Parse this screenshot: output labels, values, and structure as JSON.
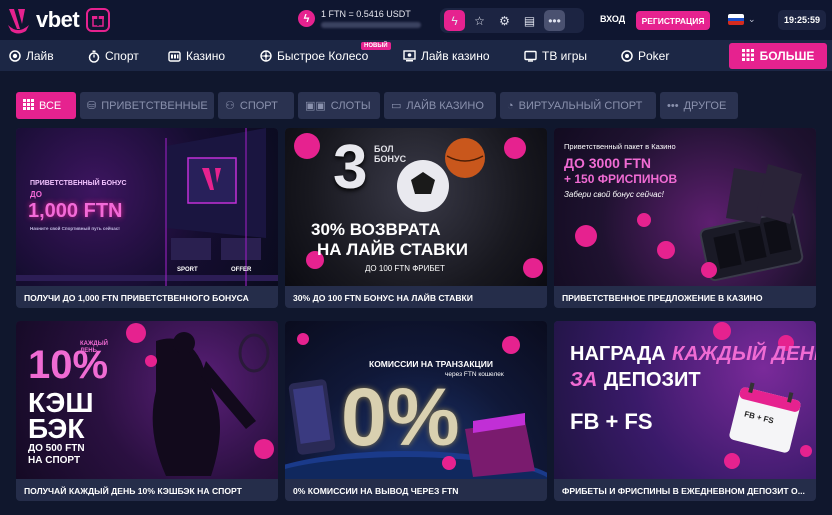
{
  "header": {
    "brand": "vbet",
    "rate": "1 FTN = 0.5416 USDT",
    "login_label": "ВХОД",
    "register_label": "РЕГИСТРАЦИЯ",
    "time": "19:25:59"
  },
  "nav": {
    "items": [
      {
        "label": "Лайв",
        "icon": "live-icon"
      },
      {
        "label": "Спорт",
        "icon": "stopwatch-icon"
      },
      {
        "label": "Казино",
        "icon": "casino-icon"
      },
      {
        "label": "Быстрое Колесо",
        "icon": "wheel-icon"
      },
      {
        "label": "Лайв казино",
        "icon": "live-casino-icon"
      },
      {
        "label": "ТВ игры",
        "icon": "tv-icon"
      },
      {
        "label": "Poker",
        "icon": "poker-chip-icon"
      }
    ],
    "new_badge": "НОВЫЙ",
    "more_label": "БОЛЬШЕ"
  },
  "filters": [
    {
      "label": "ВСЕ",
      "active": true
    },
    {
      "label": "ПРИВЕТСТВЕННЫЕ",
      "active": false
    },
    {
      "label": "СПОРТ",
      "active": false
    },
    {
      "label": "СЛОТЫ",
      "active": false
    },
    {
      "label": "ЛАЙВ КАЗИНО",
      "active": false
    },
    {
      "label": "ВИРТУАЛЬНЫЙ СПОРТ",
      "active": false
    },
    {
      "label": "ДРУГОЕ",
      "active": false
    }
  ],
  "promos": [
    {
      "title": "ПОЛУЧИ ДО 1,000 FTN ПРИВЕТСТВЕННОГО БОНУСА",
      "art": {
        "line1": "ПРИВЕТСТВЕННЫЙ БОНУС",
        "line2": "ДО",
        "line3": "1,000 FTN",
        "line4": "Начните свой Спортивный путь сейчас!",
        "tag1": "SPORT",
        "tag2": "OFFER"
      }
    },
    {
      "title": "30% ДО 100 FTN БОНУС НА ЛАЙВ СТАВКИ",
      "art": {
        "big": "3",
        "side1": "БОЛ",
        "side2": "БОНУС",
        "line1": "30% ВОЗВРАТА",
        "line2": "НА ЛАЙВ СТАВКИ",
        "line3": "ДО 100 FTN ФРИБЕТ"
      }
    },
    {
      "title": "ПРИВЕТСТВЕННОЕ ПРЕДЛОЖЕНИЕ В КАЗИНО",
      "art": {
        "line1": "Приветственный пакет в Казино",
        "line2": "ДО 3000 FTN",
        "line3": "+ 150 ФРИСПИНОВ",
        "line4": "Забери свой бонус сейчас!"
      }
    },
    {
      "title": "ПОЛУЧАЙ КАЖДЫЙ ДЕНЬ 10% КЭШБЭК НА СПОРТ",
      "art": {
        "small": "КАЖДЫЙ ДЕНЬ",
        "big": "10%",
        "line1": "КЭШ",
        "line2": "БЭК",
        "line3": "ДО 500 FTN",
        "line4": "НА СПОРТ"
      }
    },
    {
      "title": "0% КОМИССИИ НА ВЫВОД ЧЕРЕЗ FTN",
      "art": {
        "line1": "КОМИССИИ НА ТРАНЗАКЦИИ",
        "line2": "через FTN кошелек",
        "big": "0%"
      }
    },
    {
      "title": "ФРИБЕТЫ И ФРИСПИНЫ В ЕЖЕДНЕВНОМ ДЕПОЗИТ О...",
      "art": {
        "line1": "НАГРАДА",
        "line1b": "КАЖДЫЙ ДЕНЬ",
        "line2a": "ЗА",
        "line2b": "ДЕПОЗИТ",
        "line3": "FB + FS",
        "calendar": "FB + FS"
      }
    }
  ]
}
